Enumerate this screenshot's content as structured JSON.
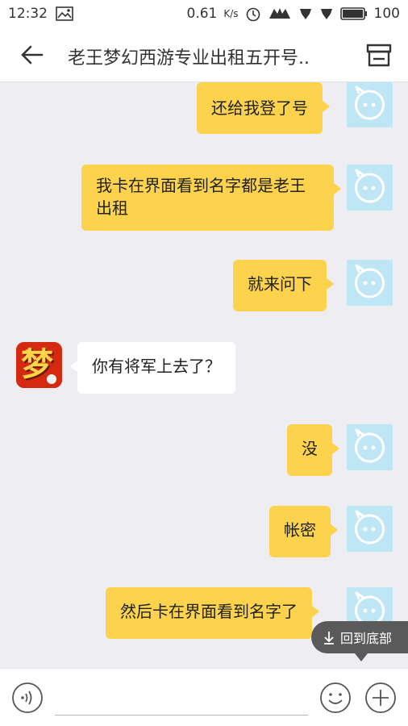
{
  "status_bar": {
    "time": "12:32",
    "speed": "0.61",
    "speed_unit": "K/s",
    "battery": "100"
  },
  "header": {
    "title": "老王梦幻西游专业出租五开号.."
  },
  "messages": [
    {
      "side": "me",
      "text": "还给我登了号"
    },
    {
      "side": "me",
      "text": "我卡在界面看到名字都是老王出租"
    },
    {
      "side": "me",
      "text": "就来问下"
    },
    {
      "side": "other",
      "text": "你有将军上去了？"
    },
    {
      "side": "me",
      "text": "没"
    },
    {
      "side": "me",
      "text": "帐密"
    },
    {
      "side": "me",
      "text": "然后卡在界面看到名字了"
    }
  ],
  "avatar_other": {
    "glyph": "梦"
  },
  "scroll_button": {
    "label": "回到底部"
  },
  "input": {
    "placeholder": ""
  },
  "colors": {
    "my_bubble": "#fdd24c",
    "other_bubble": "#ffffff",
    "my_avatar": "#bfe6f5",
    "background": "#ededf2"
  }
}
